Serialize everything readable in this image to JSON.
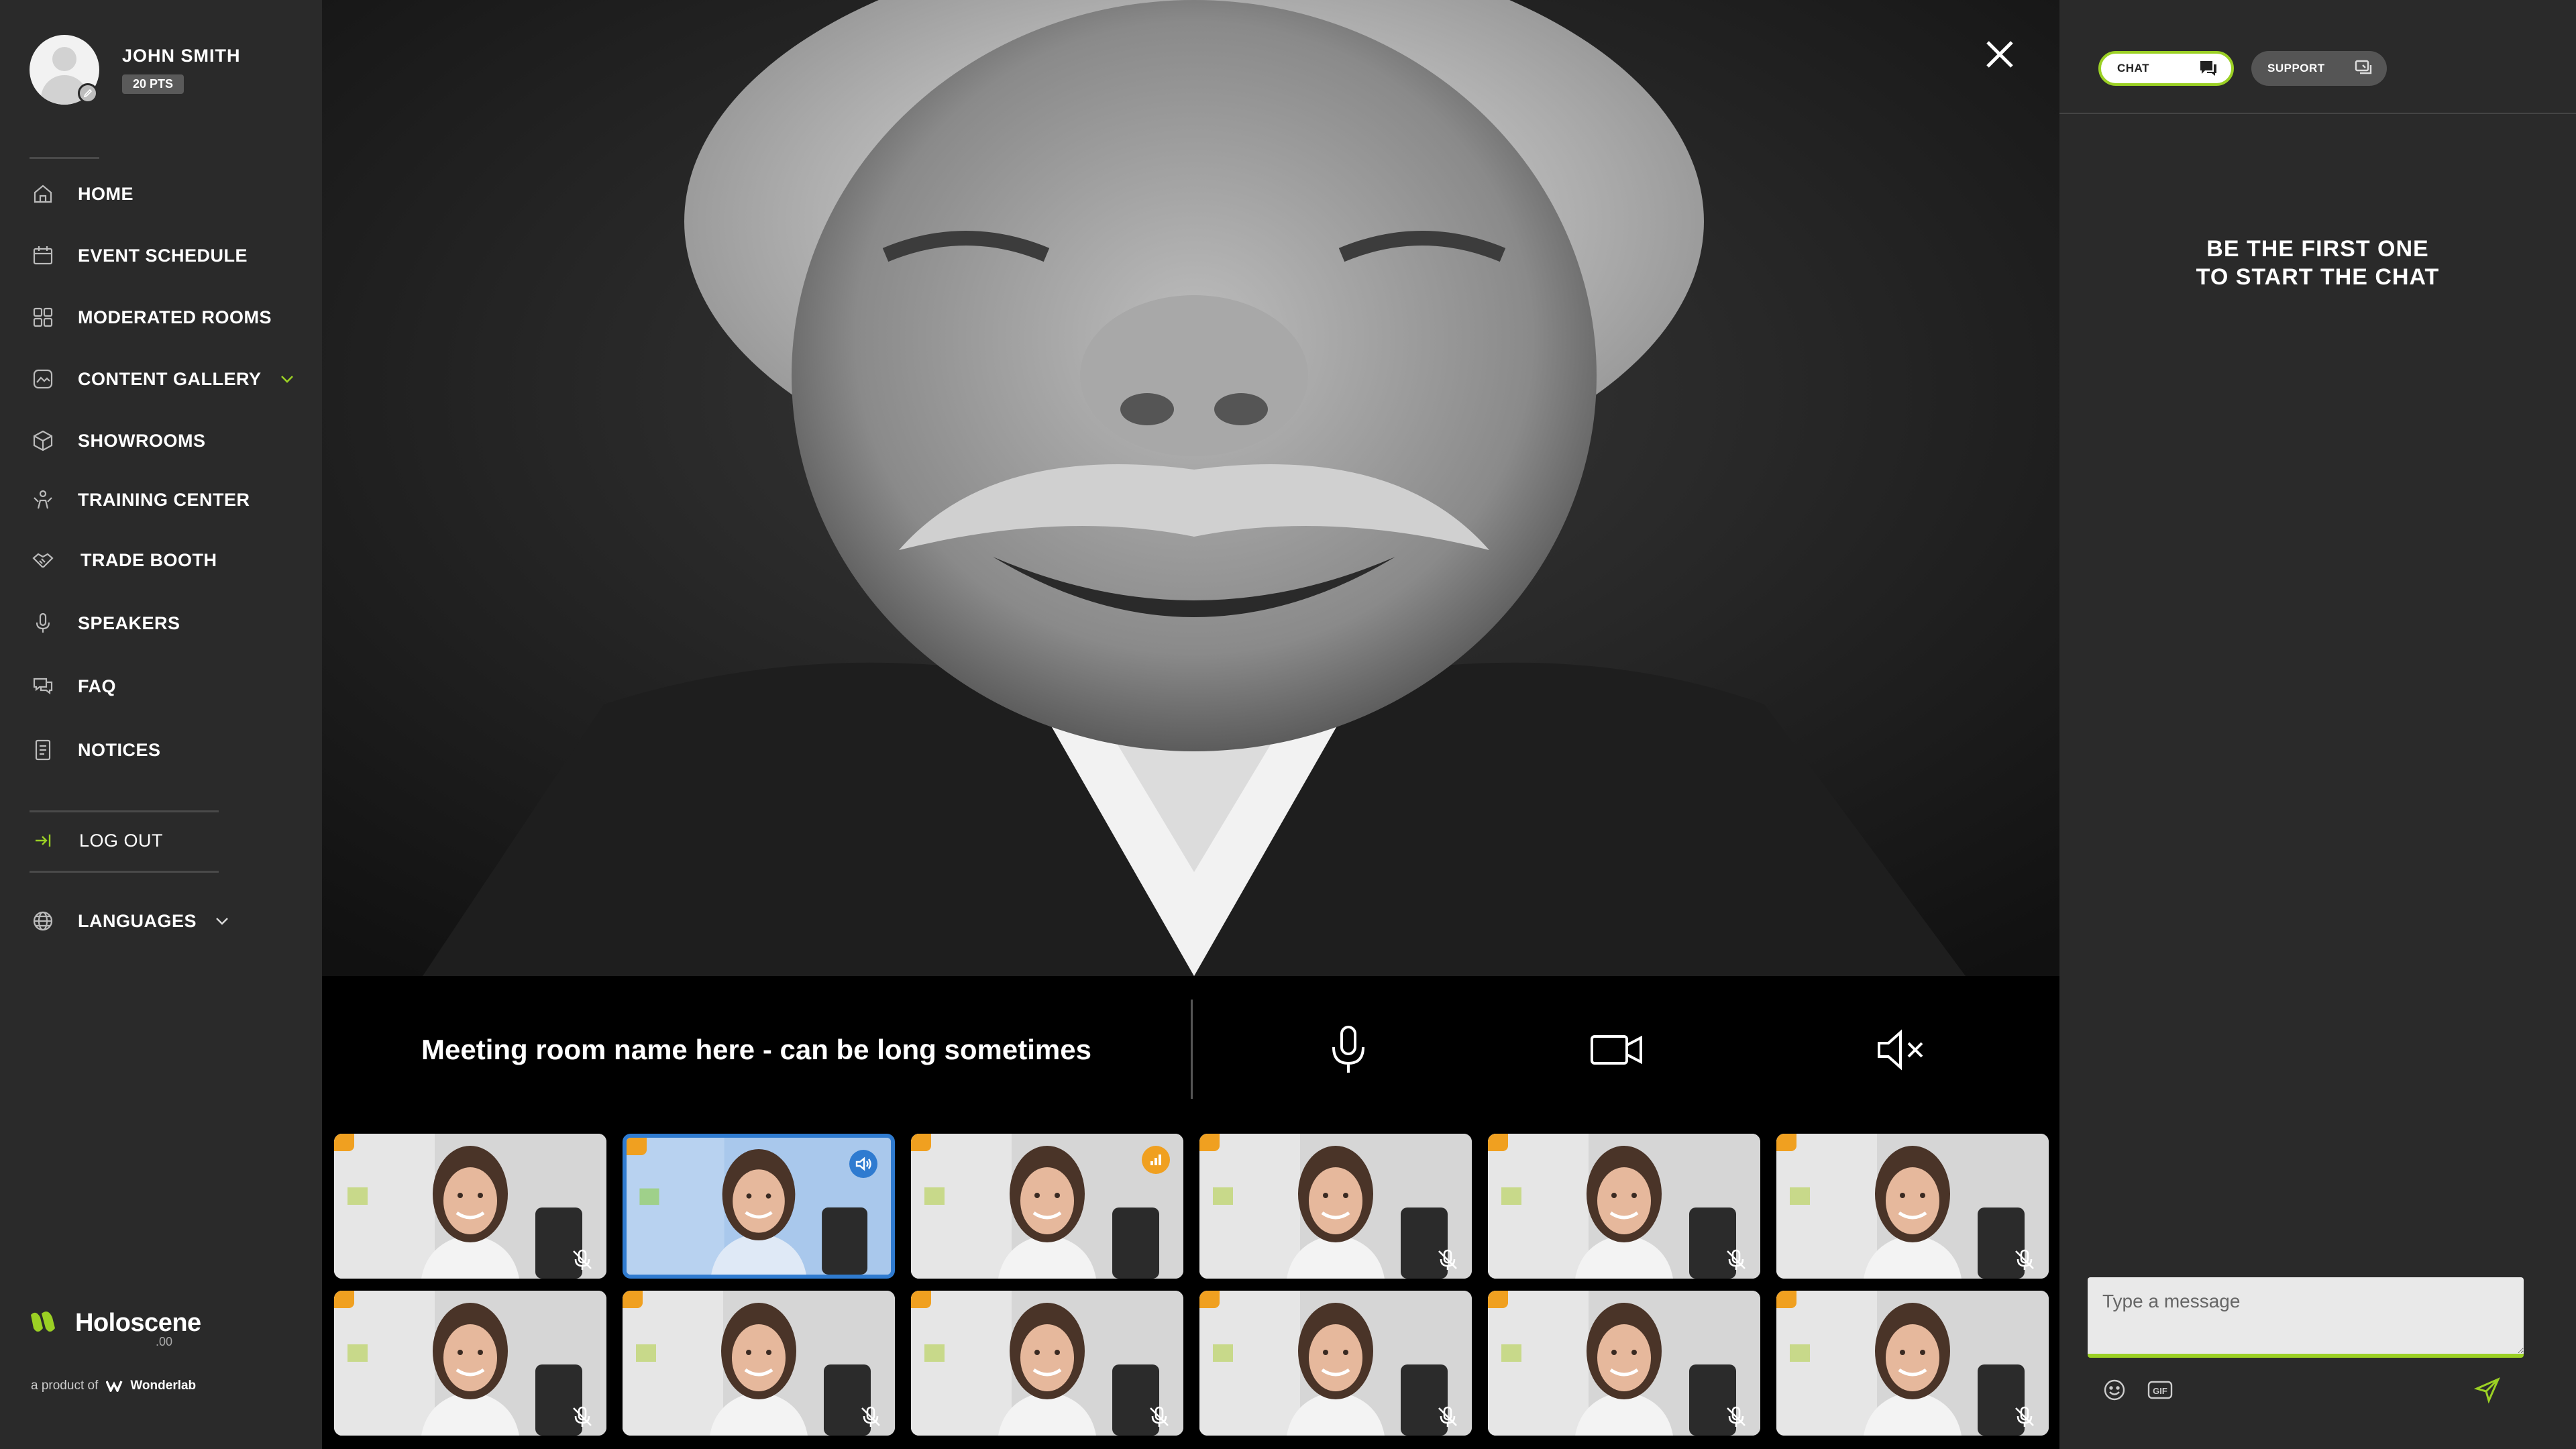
{
  "user": {
    "name": "JOHN SMITH",
    "points": "20 PTS"
  },
  "nav": [
    {
      "id": "home",
      "label": "HOME",
      "icon": "home-icon"
    },
    {
      "id": "event-schedule",
      "label": "EVENT SCHEDULE",
      "icon": "calendar-icon"
    },
    {
      "id": "moderated-rooms",
      "label": "MODERATED ROOMS",
      "icon": "grid-icon"
    },
    {
      "id": "content-gallery",
      "label": "CONTENT GALLERY",
      "icon": "gallery-icon",
      "has_dropdown": true
    },
    {
      "id": "showrooms",
      "label": "SHOWROOMS",
      "icon": "cube-icon"
    },
    {
      "id": "training-center",
      "label": "TRAINING CENTER",
      "icon": "training-icon"
    },
    {
      "id": "trade-booth",
      "label": "TRADE BOOTH",
      "icon": "handshake-icon"
    },
    {
      "id": "speakers",
      "label": "SPEAKERS",
      "icon": "microphone-icon"
    },
    {
      "id": "faq",
      "label": "FAQ",
      "icon": "chat-bubbles-icon"
    },
    {
      "id": "notices",
      "label": "NOTICES",
      "icon": "document-icon"
    }
  ],
  "logout_label": "LOG OUT",
  "languages_label": "LANGUAGES",
  "brand": {
    "name": "Holoscene",
    "sub": ".00",
    "product_prefix": "a product of",
    "company": "Wonderlab"
  },
  "meeting": {
    "room_name": "Meeting room name here - can be long sometimes"
  },
  "chat": {
    "tabs": {
      "chat": "CHAT",
      "support": "SUPPORT"
    },
    "empty_line1": "BE THE FIRST ONE",
    "empty_line2": "TO START THE CHAT",
    "input_placeholder": "Type a message",
    "gif_label": "GIF"
  },
  "colors": {
    "accent": "#9bd024",
    "sidebar_bg": "#2a2a2a",
    "active_speaker": "#2f7bd0",
    "badge_orange": "#f0a020"
  },
  "participants": [
    {
      "state": "muted"
    },
    {
      "state": "speaking"
    },
    {
      "state": "signal"
    },
    {
      "state": "muted"
    },
    {
      "state": "muted"
    },
    {
      "state": "muted"
    },
    {
      "state": "muted"
    },
    {
      "state": "muted"
    },
    {
      "state": "muted"
    },
    {
      "state": "muted"
    },
    {
      "state": "muted"
    },
    {
      "state": "muted"
    }
  ]
}
